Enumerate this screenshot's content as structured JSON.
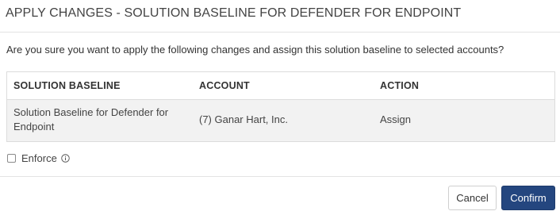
{
  "dialog": {
    "title": "APPLY CHANGES - SOLUTION BASELINE FOR DEFENDER FOR ENDPOINT",
    "prompt": "Are you sure you want to apply the following changes and assign this solution baseline to selected accounts?"
  },
  "table": {
    "headers": [
      "SOLUTION BASELINE",
      "ACCOUNT",
      "ACTION"
    ],
    "rows": [
      {
        "solution_baseline": "Solution Baseline for Defender for Endpoint",
        "account": "(7) Ganar Hart, Inc.",
        "action": "Assign"
      }
    ]
  },
  "enforce": {
    "label": "Enforce",
    "checked": false,
    "info_icon": "info-icon"
  },
  "buttons": {
    "cancel_label": "Cancel",
    "confirm_label": "Confirm"
  },
  "colors": {
    "primary": "#24467f",
    "row_background": "#f2f2f2",
    "border": "#dcdcdc"
  }
}
